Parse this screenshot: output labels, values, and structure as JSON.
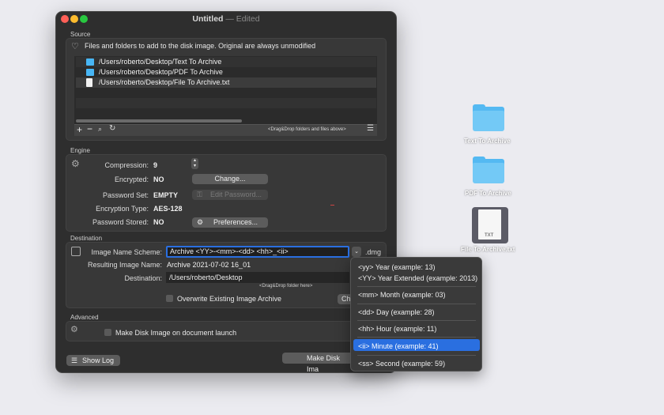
{
  "window": {
    "title": "Untitled",
    "edited": "— Edited"
  },
  "source": {
    "section_label": "Source",
    "description": "Files and folders to add to the disk image. Original are always unmodified",
    "rows": [
      {
        "path": "/Users/roberto/Desktop/Text To Archive",
        "kind": "folder"
      },
      {
        "path": "/Users/roberto/Desktop/PDF To Archive",
        "kind": "folder"
      },
      {
        "path": "/Users/roberto/Desktop/File To Archive.txt",
        "kind": "file"
      }
    ],
    "drop_hint": "<Drag&Drop folders and files above>",
    "toolbar_icons": [
      "add-icon",
      "remove-icon",
      "search-icon",
      "refresh-icon",
      "list-icon"
    ]
  },
  "engine": {
    "section_label": "Engine",
    "compression_label": "Compression:",
    "compression_value": "9",
    "encrypted_label": "Encrypted:",
    "encrypted_value": "NO",
    "change_button": "Change...",
    "password_set_label": "Password Set:",
    "password_set_value": "EMPTY",
    "edit_password_button": "Edit Password...",
    "encryption_type_label": "Encryption Type:",
    "encryption_type_value": "AES-128",
    "password_stored_label": "Password  Stored:",
    "password_stored_value": "NO",
    "preferences_button": "Preferences..."
  },
  "destination": {
    "section_label": "Destination",
    "scheme_label": "Image Name Scheme:",
    "scheme_value": "Archive <YY>-<mm>-<dd> <hh>_<ii>",
    "extension": ".dmg",
    "resulting_label": "Resulting Image Name:",
    "resulting_value": "Archive 2021-07-02 16_01",
    "destination_label": "Destination:",
    "destination_value": "/Users/roberto/Desktop",
    "drop_hint": "<Drag&Drop folder here>",
    "overwrite_label": "Overwrite Existing Image Archive",
    "choose_button_partial": "Ch"
  },
  "advanced": {
    "section_label": "Advanced",
    "make_on_launch_label": "Make Disk Image on document launch"
  },
  "footer": {
    "show_log": "Show Log",
    "make_disk_image_partial": "Make Disk Ima"
  },
  "dropdown": {
    "items": [
      "<yy> Year (example: 13)",
      "<YY> Year Extended (example: 2013)",
      "<mm> Month (example: 03)",
      "<dd> Day (example: 28)",
      "<hh> Hour (example: 11)",
      "<ii> Minute (example: 41)",
      "<ss> Second (example: 59)"
    ],
    "selected_index": 5
  },
  "desktop": {
    "items": [
      {
        "label": "Text To Archive",
        "kind": "folder"
      },
      {
        "label": "PDF To Archive",
        "kind": "folder"
      },
      {
        "label": "File To Archive.txt",
        "kind": "text-file",
        "badge": "TXT"
      }
    ]
  },
  "colors": {
    "accent": "#2a6fe0",
    "folder": "#54b9f2",
    "window_bg": "#2e2e2e",
    "desktop_bg": "#ebebf0"
  }
}
